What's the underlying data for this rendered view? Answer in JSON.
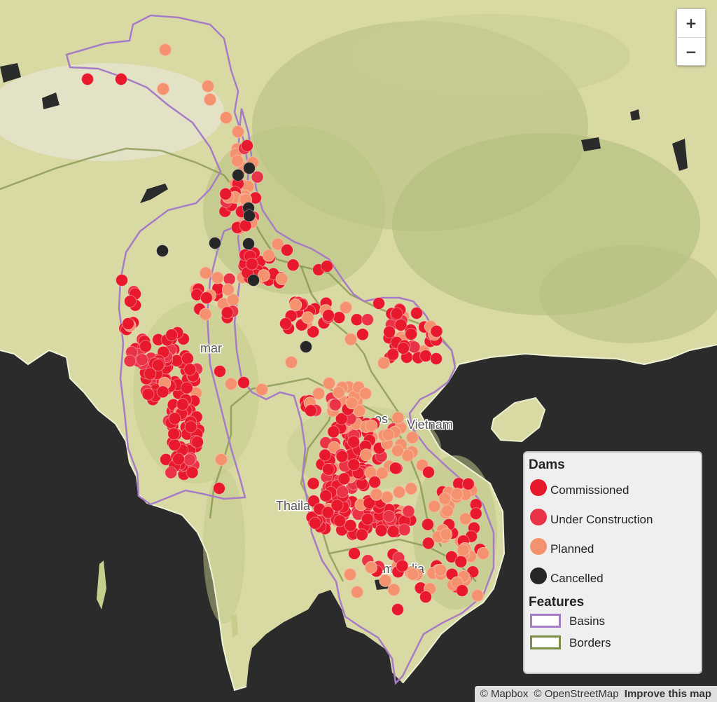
{
  "legend": {
    "dams_title": "Dams",
    "dams": [
      {
        "label": "Commissioned",
        "color": "#e8192c"
      },
      {
        "label": "Under Construction",
        "color": "#ea3346"
      },
      {
        "label": "Planned",
        "color": "#f4926f"
      },
      {
        "label": "Cancelled",
        "color": "#262626"
      }
    ],
    "features_title": "Features",
    "features": [
      {
        "label": "Basins",
        "color": "#a77cc7"
      },
      {
        "label": "Borders",
        "color": "#7d8f46"
      }
    ]
  },
  "zoom": {
    "in": "+",
    "out": "−"
  },
  "labels": {
    "myanmar": "mar",
    "vietnam": "Vietnam",
    "thailand": "Thaila",
    "cambodia": "Cambodia",
    "laos": "os"
  },
  "attribution": {
    "mapbox": "© Mapbox",
    "osm": "© OpenStreetMap",
    "improve": "Improve this map"
  }
}
